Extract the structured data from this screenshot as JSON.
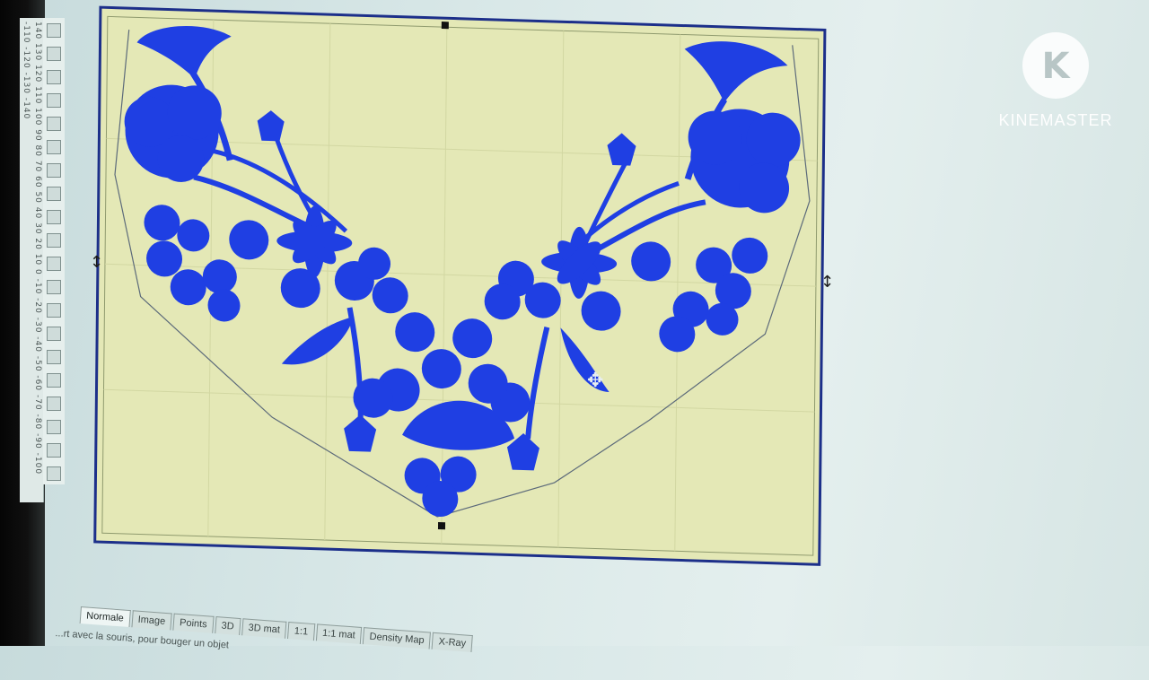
{
  "ruler": {
    "vertical_marks": "140 130 120 110 100 90 80 70 60 50 40 30 20 10 0 -10 -20 -30 -40 -50 -60 -70 -80 -90 -100 -110 -120 -130 -140"
  },
  "tools": [
    "",
    "",
    "",
    "",
    "",
    "",
    "",
    "",
    "",
    "",
    "",
    "",
    "",
    "",
    "",
    "",
    "",
    "",
    "",
    ""
  ],
  "design": {
    "canvas_bg": "#e4e8b6",
    "thread_color": "#1f3fe3",
    "frame_color": "#1c2f8a",
    "outline_color": "#5c6a7a"
  },
  "watermark": {
    "logo_letter": "K",
    "brand": "KINEMASTER"
  },
  "tabs": [
    {
      "label": "Normale",
      "active": true
    },
    {
      "label": "Image",
      "active": false
    },
    {
      "label": "Points",
      "active": false
    },
    {
      "label": "3D",
      "active": false
    },
    {
      "label": "3D mat",
      "active": false
    },
    {
      "label": "1:1",
      "active": false
    },
    {
      "label": "1:1 mat",
      "active": false
    },
    {
      "label": "Density Map",
      "active": false
    },
    {
      "label": "X-Ray",
      "active": false
    }
  ],
  "status": {
    "text": "...rt avec la souris, pour bouger un objet"
  }
}
